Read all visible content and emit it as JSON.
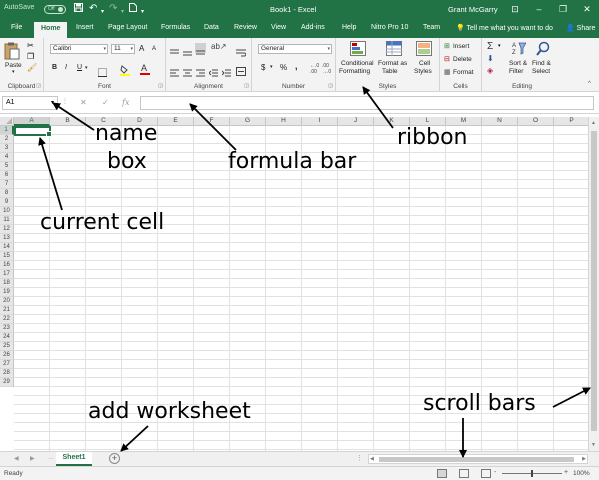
{
  "titlebar": {
    "autosave_label": "AutoSave",
    "autosave_state": "Off",
    "title": "Book1 - Excel",
    "user": "Grant McGarry",
    "save_icon": "save-icon",
    "undo_icon": "undo-icon",
    "redo_icon": "redo-icon"
  },
  "tabs": [
    {
      "label": "File"
    },
    {
      "label": "Home"
    },
    {
      "label": "Insert"
    },
    {
      "label": "Page Layout"
    },
    {
      "label": "Formulas"
    },
    {
      "label": "Data"
    },
    {
      "label": "Review"
    },
    {
      "label": "View"
    },
    {
      "label": "Add-ins"
    },
    {
      "label": "Help"
    },
    {
      "label": "Nitro Pro 10"
    },
    {
      "label": "Team"
    }
  ],
  "active_tab": "Home",
  "tell_me": "Tell me what you want to do",
  "share_label": "Share",
  "ribbon": {
    "clipboard": {
      "label": "Clipboard",
      "paste": "Paste"
    },
    "font": {
      "label": "Font",
      "family": "Calibri",
      "size": "11",
      "bold": "B",
      "italic": "I",
      "underline": "U",
      "grow": "A",
      "shrink": "A"
    },
    "alignment": {
      "label": "Alignment"
    },
    "number": {
      "label": "Number",
      "format": "General",
      "currency": "$",
      "percent": "%",
      "comma": ","
    },
    "styles": {
      "label": "Styles",
      "conditional_line1": "Conditional",
      "conditional_line2": "Formatting",
      "format_table_line1": "Format as",
      "format_table_line2": "Table",
      "cell_styles_line1": "Cell",
      "cell_styles_line2": "Styles"
    },
    "cells": {
      "label": "Cells",
      "insert": "Insert",
      "delete": "Delete",
      "format": "Format"
    },
    "editing": {
      "label": "Editing",
      "sort_line1": "Sort &",
      "sort_line2": "Filter",
      "find_line1": "Find &",
      "find_line2": "Select"
    }
  },
  "formula_bar": {
    "name_box": "A1",
    "cancel": "✕",
    "enter": "✓",
    "fx": "fx",
    "value": ""
  },
  "grid": {
    "columns": [
      "A",
      "B",
      "C",
      "D",
      "E",
      "F",
      "G",
      "H",
      "I",
      "J",
      "K",
      "L",
      "M",
      "N",
      "O",
      "P"
    ],
    "rows": [
      "1",
      "2",
      "3",
      "4",
      "5",
      "6",
      "7",
      "8",
      "9",
      "10",
      "11",
      "12",
      "13",
      "14",
      "15",
      "16",
      "17",
      "18",
      "19",
      "20",
      "21",
      "22",
      "23",
      "24",
      "25",
      "26",
      "27",
      "28",
      "29"
    ],
    "selected_cell": "A1"
  },
  "sheets": [
    {
      "name": "Sheet1"
    }
  ],
  "add_sheet": "+",
  "status": {
    "ready": "Ready",
    "zoom": "100%",
    "zoom_minus": "-",
    "zoom_plus": "+"
  },
  "annotations": {
    "name_box_line1": "name",
    "name_box_line2": "box",
    "formula_bar": "formula bar",
    "ribbon": "ribbon",
    "current_cell": "current cell",
    "add_worksheet": "add worksheet",
    "scroll_bars": "scroll bars"
  },
  "colors": {
    "excel_green": "#217346",
    "ribbon_bg": "#f3f3f3",
    "header_bg": "#e6e6e6"
  }
}
